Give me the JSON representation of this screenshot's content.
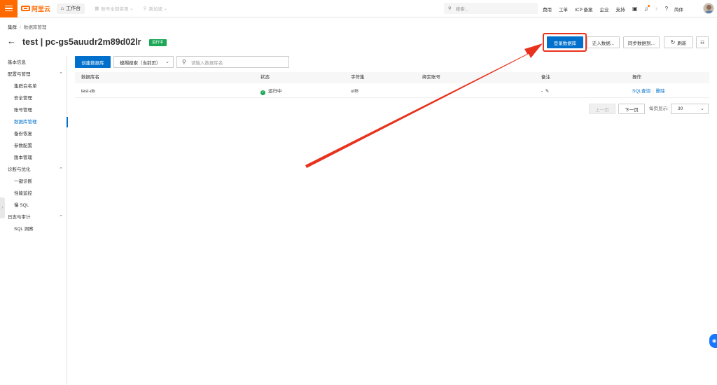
{
  "topbar": {
    "logo_text": "阿里云",
    "workbench": "工作台",
    "account_scope": "账号全部资源",
    "region": "新加坡",
    "search_placeholder": "搜索...",
    "links": [
      "费用",
      "工单",
      "ICP 备案",
      "企业",
      "支持"
    ],
    "lang": "简体"
  },
  "breadcrumb": {
    "root": "集群",
    "separator": "/",
    "current": "数据库管理"
  },
  "header": {
    "title": "test | pc-gs5auudr2m89d02lr",
    "status": "运行中",
    "buttons": {
      "login_db": "登录数据库",
      "import_data": "迁入数据...",
      "sync_data": "同步数据到...",
      "refresh": "刷新"
    }
  },
  "sidebar": {
    "items": [
      {
        "label": "基本信息",
        "level": "group",
        "expandable": false
      },
      {
        "label": "配置与管理",
        "level": "group",
        "expandable": true
      },
      {
        "label": "集群白名单",
        "level": "sub"
      },
      {
        "label": "安全管理",
        "level": "sub"
      },
      {
        "label": "账号管理",
        "level": "sub"
      },
      {
        "label": "数据库管理",
        "level": "sub",
        "active": true
      },
      {
        "label": "备份恢复",
        "level": "sub"
      },
      {
        "label": "参数配置",
        "level": "sub"
      },
      {
        "label": "版本管理",
        "level": "sub"
      },
      {
        "label": "诊断与优化",
        "level": "group",
        "expandable": true
      },
      {
        "label": "一键诊断",
        "level": "sub"
      },
      {
        "label": "性能监控",
        "level": "sub"
      },
      {
        "label": "慢 SQL",
        "level": "sub"
      },
      {
        "label": "日志与审计",
        "level": "group",
        "expandable": true
      },
      {
        "label": "SQL 洞察",
        "level": "sub"
      }
    ]
  },
  "toolbar": {
    "create_db": "创建数据库",
    "fuzzy_search": "模糊搜索（当前页）",
    "search_placeholder": "请输入数据库名"
  },
  "table": {
    "columns": [
      "数据库名",
      "状态",
      "字符集",
      "绑定账号",
      "备注",
      "操作"
    ],
    "rows": [
      {
        "name": "test-db",
        "status": "运行中",
        "charset": "utf8",
        "account": "",
        "remark": "-",
        "actions": [
          "SQL查询",
          "删除"
        ]
      }
    ]
  },
  "pagination": {
    "prev": "上一页",
    "next": "下一页",
    "page_size_label": "每页显示:",
    "page_size": "30"
  },
  "colors": {
    "brand": "#ff6a00",
    "primary": "#0070cc",
    "success": "#1da857",
    "annotation": "#e8321d"
  }
}
